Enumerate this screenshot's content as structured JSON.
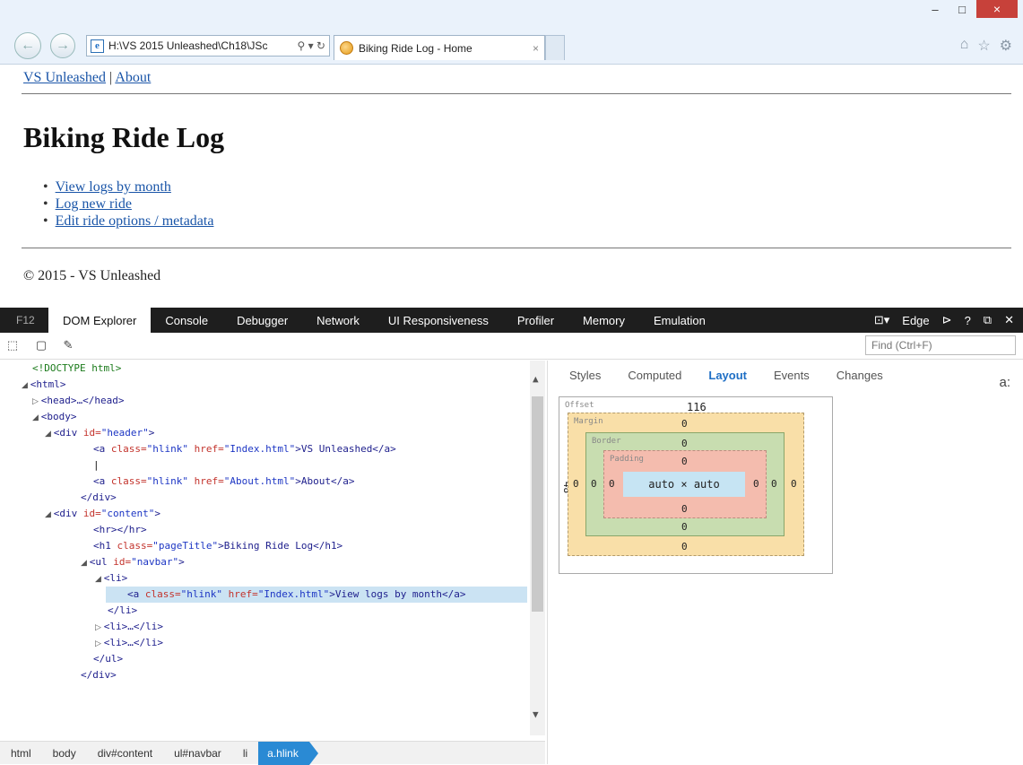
{
  "browser": {
    "address": "H:\\VS 2015 Unleashed\\Ch18\\JSc",
    "tab_title": "Biking Ride Log - Home",
    "tab_close": "×",
    "window_min": "–",
    "window_max": "□",
    "window_close": "×",
    "back_glyph": "←",
    "forward_glyph": "→",
    "addr_icons": "⚲ ▾ ↻",
    "home_icon": "⌂",
    "star_icon": "☆",
    "gear_icon": "⚙"
  },
  "page": {
    "links": [
      "VS Unleashed",
      "About"
    ],
    "separator": "|",
    "title": "Biking Ride Log",
    "nav": [
      "View logs by month",
      "Log new ride",
      "Edit ride options / metadata"
    ],
    "footer": "© 2015 - VS Unleashed"
  },
  "devtools": {
    "label": "F12",
    "tabs": [
      "DOM Explorer",
      "Console",
      "Debugger",
      "Network",
      "UI Responsiveness",
      "Profiler",
      "Memory",
      "Emulation"
    ],
    "active_tab": "DOM Explorer",
    "mode": "Edge",
    "help": "?",
    "find_placeholder": "Find (Ctrl+F)",
    "breadcrumbs": [
      "html",
      "body",
      "div#content",
      "ul#navbar",
      "li",
      "a.hlink"
    ],
    "side_tabs": [
      "Styles",
      "Computed",
      "Layout",
      "Events",
      "Changes"
    ],
    "active_side_tab": "Layout",
    "a_label": "a:",
    "layout": {
      "offset_label": "Offset",
      "margin_label": "Margin",
      "border_label": "Border",
      "padding_label": "Padding",
      "offset_top": "116",
      "offset_left": "48",
      "margin_top": "0",
      "margin_bottom": "0",
      "margin_left": "0",
      "margin_right": "0",
      "border_top": "0",
      "border_bottom": "0",
      "border_left": "0",
      "border_right": "0",
      "padding_top": "0",
      "padding_bottom": "0",
      "padding_left": "0",
      "padding_right": "0",
      "content": "auto × auto"
    },
    "dom": {
      "doctype": "<!DOCTYPE html>",
      "html_open": "<html>",
      "head": "<head>…</head>",
      "body_open": "<body>",
      "div_lt": "<div ",
      "div_header_attr": "id=",
      "div_header_val": "\"header\"",
      "gt": ">",
      "a_lt": "<a ",
      "class_attr": "class=",
      "hlink_val": "\"hlink\"",
      "href_attr": " href=",
      "index_val": "\"Index.html\"",
      "vs_text": ">VS Unleashed</a>",
      "pipe": "|",
      "about_val": "\"About.html\"",
      "about_text": ">About</a>",
      "div_close": "</div>",
      "div_content_val": "\"content\"",
      "hr": "<hr></hr>",
      "h1_lt": "<h1 ",
      "pagetitle_val": "\"pageTitle\"",
      "h1_text": ">Biking Ride Log</h1>",
      "ul_lt": "<ul ",
      "navbar_val": "\"navbar\"",
      "li_open": "<li>",
      "view_text": ">View logs by month</a>",
      "li_close": "</li>",
      "li_collapsed": "<li>…</li>",
      "ul_close": "</ul>"
    }
  }
}
